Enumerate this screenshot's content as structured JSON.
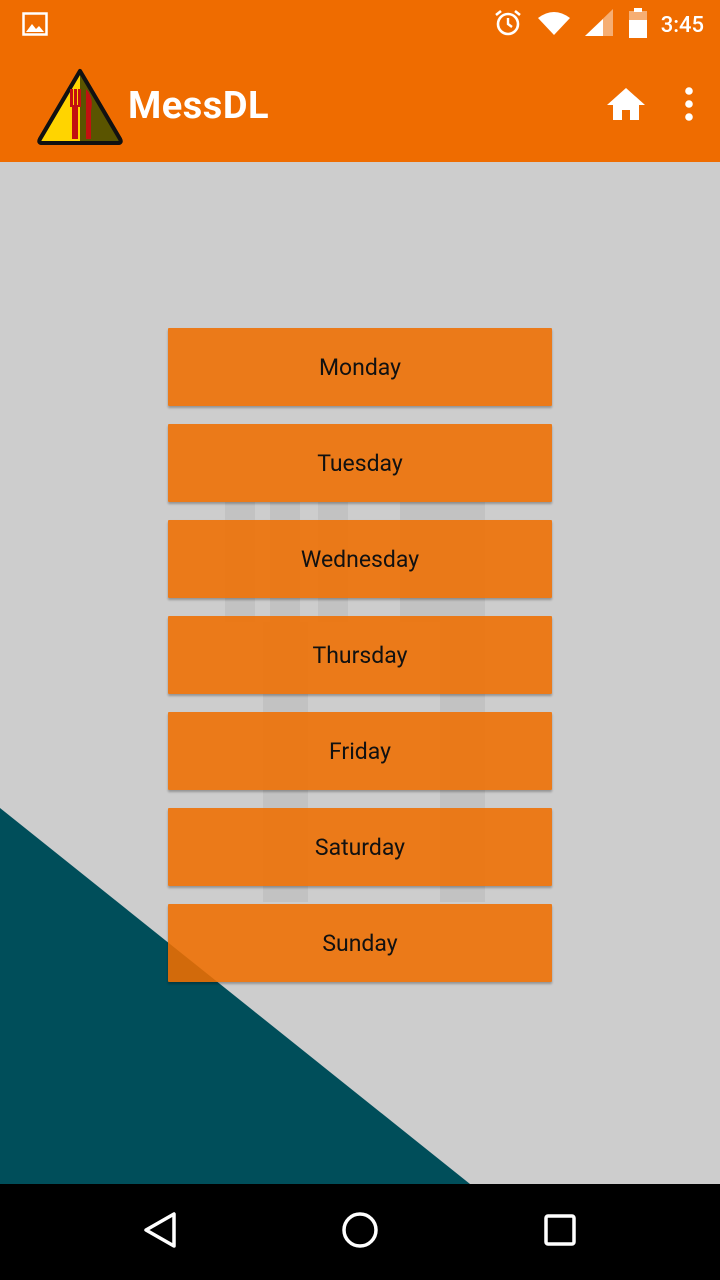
{
  "status_bar": {
    "time": "3:45",
    "icons": [
      "image-icon",
      "alarm-icon",
      "wifi-icon",
      "signal-icon",
      "battery-icon"
    ]
  },
  "app_bar": {
    "title": "MessDL",
    "logo_icon": "fork-knife-warning-icon",
    "actions": [
      "home-icon",
      "overflow-menu-icon"
    ]
  },
  "days": [
    "Monday",
    "Tuesday",
    "Wednesday",
    "Thursday",
    "Friday",
    "Saturday",
    "Sunday"
  ],
  "nav_bar": {
    "buttons": [
      "back-icon",
      "home-circle-icon",
      "recents-icon"
    ]
  },
  "colors": {
    "primary": "#ef6c00",
    "button": "#ef7a1a",
    "background": "#cdcdcd",
    "accent_shape": "#004e5a",
    "nav_bar": "#000000"
  }
}
